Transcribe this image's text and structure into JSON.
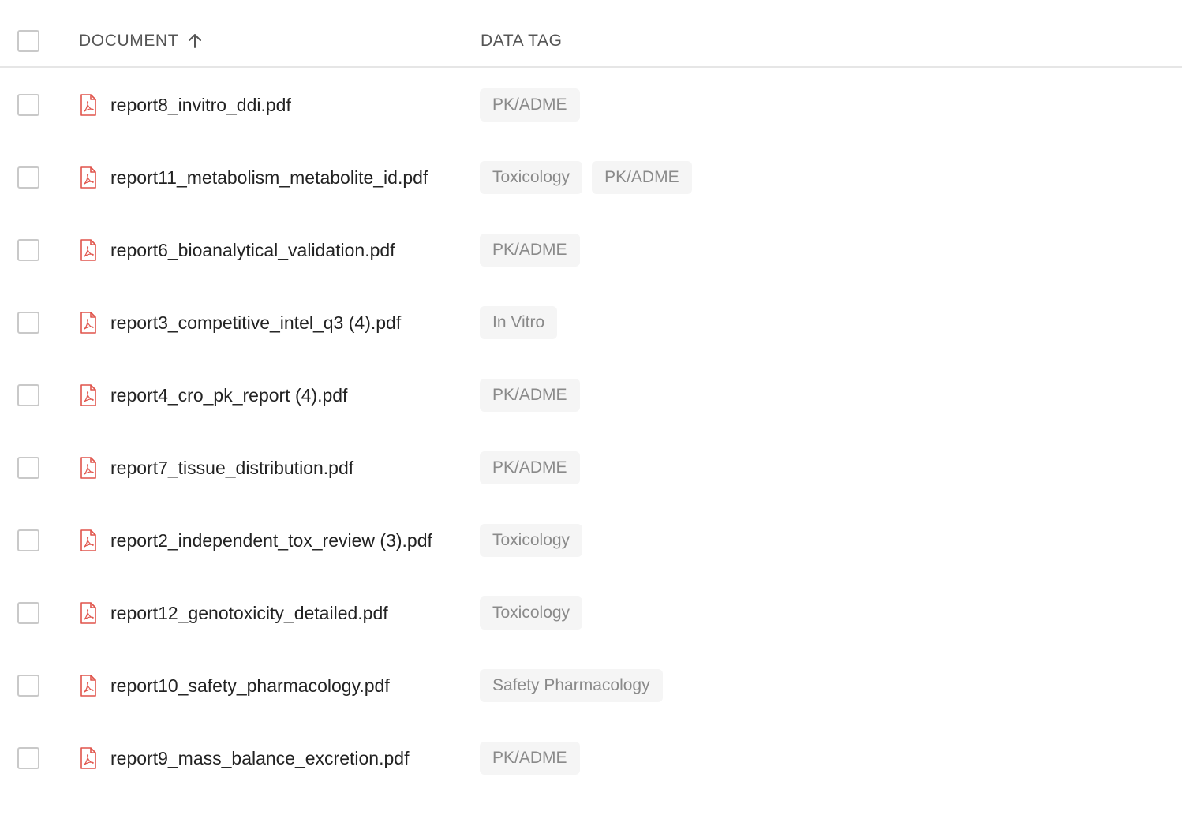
{
  "header": {
    "document_label": "DOCUMENT",
    "data_tag_label": "DATA TAG",
    "sort_icon": "arrow-up-icon"
  },
  "colors": {
    "pdf_icon": "#e0544b",
    "tag_bg": "#f5f5f5",
    "tag_text": "#8a8a8a",
    "checkbox_border": "#c9c9c9"
  },
  "rows": [
    {
      "name": "report8_invitro_ddi.pdf",
      "icon": "pdf-file-icon",
      "tags": [
        "PK/ADME"
      ]
    },
    {
      "name": "report11_metabolism_metabolite_id.pdf",
      "icon": "pdf-file-icon",
      "tags": [
        "Toxicology",
        "PK/ADME"
      ]
    },
    {
      "name": "report6_bioanalytical_validation.pdf",
      "icon": "pdf-file-icon",
      "tags": [
        "PK/ADME"
      ]
    },
    {
      "name": "report3_competitive_intel_q3 (4).pdf",
      "icon": "pdf-file-icon",
      "tags": [
        "In Vitro"
      ]
    },
    {
      "name": "report4_cro_pk_report (4).pdf",
      "icon": "pdf-file-icon",
      "tags": [
        "PK/ADME"
      ]
    },
    {
      "name": "report7_tissue_distribution.pdf",
      "icon": "pdf-file-icon",
      "tags": [
        "PK/ADME"
      ]
    },
    {
      "name": "report2_independent_tox_review (3).pdf",
      "icon": "pdf-file-icon",
      "tags": [
        "Toxicology"
      ]
    },
    {
      "name": "report12_genotoxicity_detailed.pdf",
      "icon": "pdf-file-icon",
      "tags": [
        "Toxicology"
      ]
    },
    {
      "name": "report10_safety_pharmacology.pdf",
      "icon": "pdf-file-icon",
      "tags": [
        "Safety Pharmacology"
      ]
    },
    {
      "name": "report9_mass_balance_excretion.pdf",
      "icon": "pdf-file-icon",
      "tags": [
        "PK/ADME"
      ]
    }
  ]
}
